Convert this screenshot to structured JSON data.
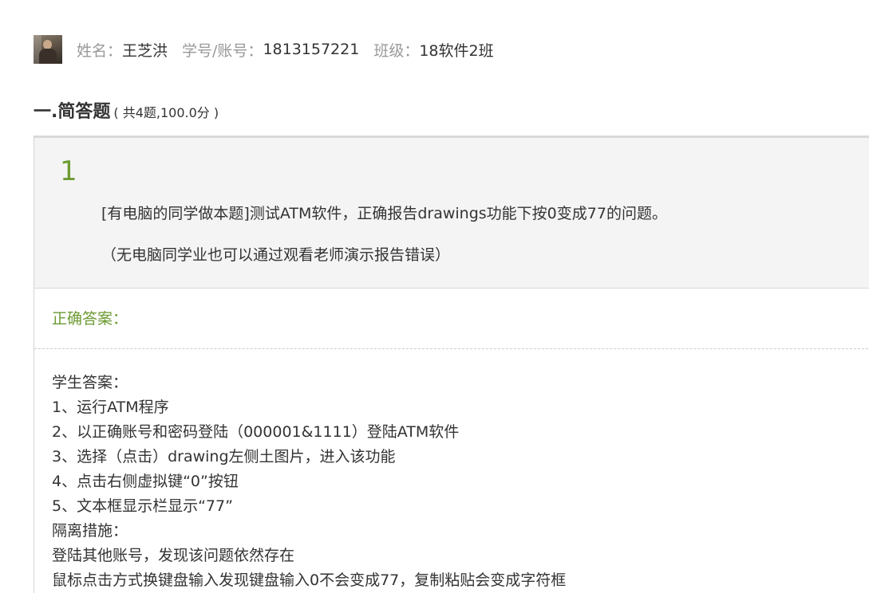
{
  "student": {
    "name_label": "姓名：",
    "name": "王芝洪",
    "id_label": "学号/账号：",
    "id": "1813157221",
    "class_label": "班级：",
    "class": "18软件2班"
  },
  "section": {
    "title": "一.简答题",
    "subtitle": "( 共4题,100.0分 )"
  },
  "question": {
    "number": "1",
    "text_line1": "[有电脑的同学做本题]测试ATM软件，正确报告drawings功能下按0变成77的问题。",
    "text_line2": "（无电脑同学业也可以通过观看老师演示报告错误）",
    "correct_answer_label": "正确答案：",
    "student_answer_lines": [
      "学生答案：",
      "1、运行ATM程序",
      "2、以正确账号和密码登陆（000001&1111）登陆ATM软件",
      "3、选择（点击）drawing左侧土图片，进入该功能",
      "4、点击右侧虚拟键“0”按钮",
      "5、文本框显示栏显示“77”",
      "隔离措施：",
      "登陆其他账号，发现该问题依然存在",
      "鼠标点击方式换键盘输入发现键盘输入0不会变成77，复制粘贴会变成字符框"
    ]
  }
}
